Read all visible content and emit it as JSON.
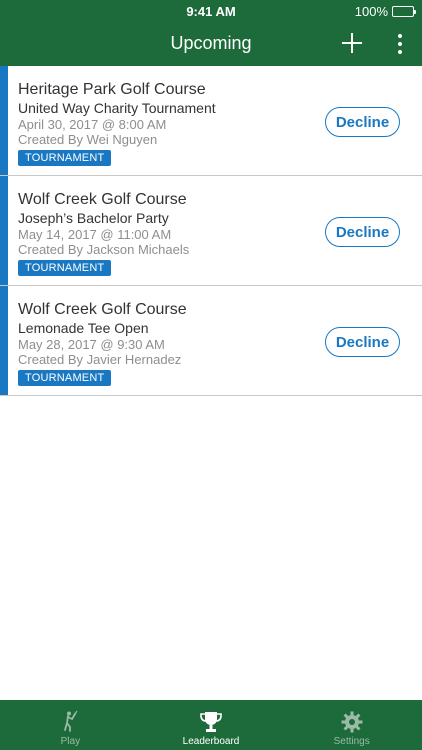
{
  "status_bar": {
    "time": "9:41 AM",
    "battery": "100%"
  },
  "nav": {
    "title": "Upcoming",
    "add_icon": "plus-icon",
    "more_icon": "more-vertical-icon"
  },
  "colors": {
    "brand_green": "#1d6b3a",
    "accent_blue": "#1a78c2"
  },
  "rows": [
    {
      "course": "Heritage Park Golf Course",
      "event": "United Way Charity Tournament",
      "date": "April 30, 2017 @ 8:00 AM",
      "creator": "Created By Wei Nguyen",
      "tag": "TOURNAMENT",
      "action": "Decline"
    },
    {
      "course": "Wolf Creek Golf Course",
      "event": "Joseph’s Bachelor Party",
      "date": "May 14, 2017 @ 11:00 AM",
      "creator": "Created By Jackson Michaels",
      "tag": "TOURNAMENT",
      "action": "Decline"
    },
    {
      "course": "Wolf Creek Golf Course",
      "event": "Lemonade Tee Open",
      "date": "May 28, 2017 @ 9:30 AM",
      "creator": "Created By Javier Hernadez",
      "tag": "TOURNAMENT",
      "action": "Decline"
    }
  ],
  "tabbar": {
    "tabs": [
      {
        "label": "Play",
        "icon": "golfer-icon",
        "active": false
      },
      {
        "label": "Leaderboard",
        "icon": "trophy-icon",
        "active": true
      },
      {
        "label": "Settings",
        "icon": "gear-icon",
        "active": false
      }
    ]
  }
}
